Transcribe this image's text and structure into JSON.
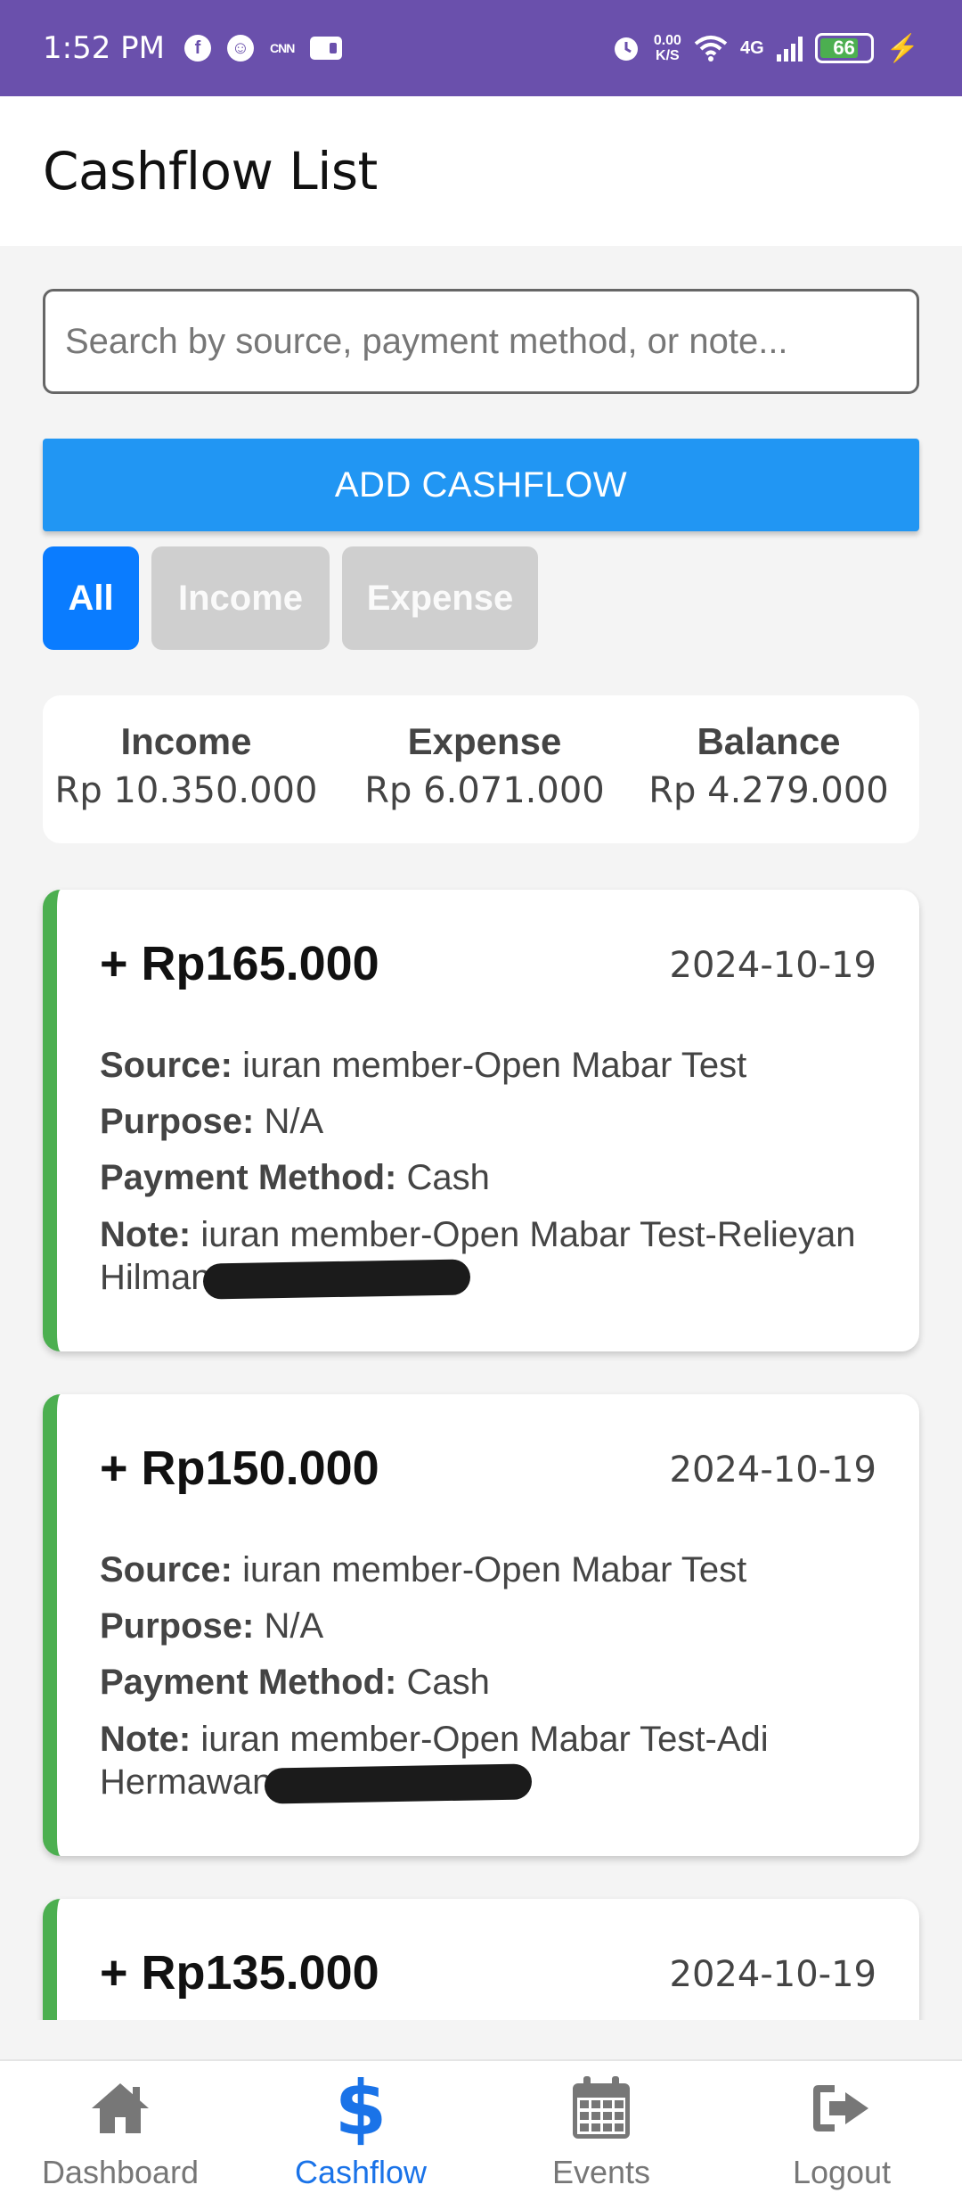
{
  "status_bar": {
    "time": "1:52 PM",
    "net_speed_value": "0.00",
    "net_speed_unit": "K/S",
    "network": "4G",
    "battery": "66"
  },
  "header": {
    "title": "Cashflow List"
  },
  "search": {
    "placeholder": "Search by source, payment method, or note...",
    "value": ""
  },
  "add_button": {
    "label": "ADD CASHFLOW"
  },
  "filters": {
    "all": "All",
    "income": "Income",
    "expense": "Expense",
    "selected": "All"
  },
  "summary": {
    "income_label": "Income",
    "income_value": "Rp 10.350.000",
    "expense_label": "Expense",
    "expense_value": "Rp 6.071.000",
    "balance_label": "Balance",
    "balance_value": "Rp 4.279.000"
  },
  "field_labels": {
    "source": "Source:",
    "purpose": "Purpose:",
    "payment_method": "Payment Method:",
    "note": "Note:"
  },
  "transactions": [
    {
      "amount": "+ Rp165.000",
      "date": "2024-10-19",
      "source": "iuran member-Open Mabar Test",
      "purpose": "N/A",
      "payment_method": "Cash",
      "note": "iuran member-Open Mabar Test-Relieyan Hilman"
    },
    {
      "amount": "+ Rp150.000",
      "date": "2024-10-19",
      "source": "iuran member-Open Mabar Test",
      "purpose": "N/A",
      "payment_method": "Cash",
      "note": "iuran member-Open Mabar Test-Adi Hermawan"
    },
    {
      "amount": "+ Rp135.000",
      "date": "2024-10-19"
    }
  ],
  "bottom_nav": {
    "dashboard": "Dashboard",
    "cashflow": "Cashflow",
    "events": "Events",
    "logout": "Logout",
    "active": "Cashflow"
  },
  "colors": {
    "status_bar": "#6a50ac",
    "primary_button": "#2196f3",
    "active_chip": "#0a7cff",
    "income_accent": "#4caf50",
    "nav_active": "#1a73e8"
  }
}
